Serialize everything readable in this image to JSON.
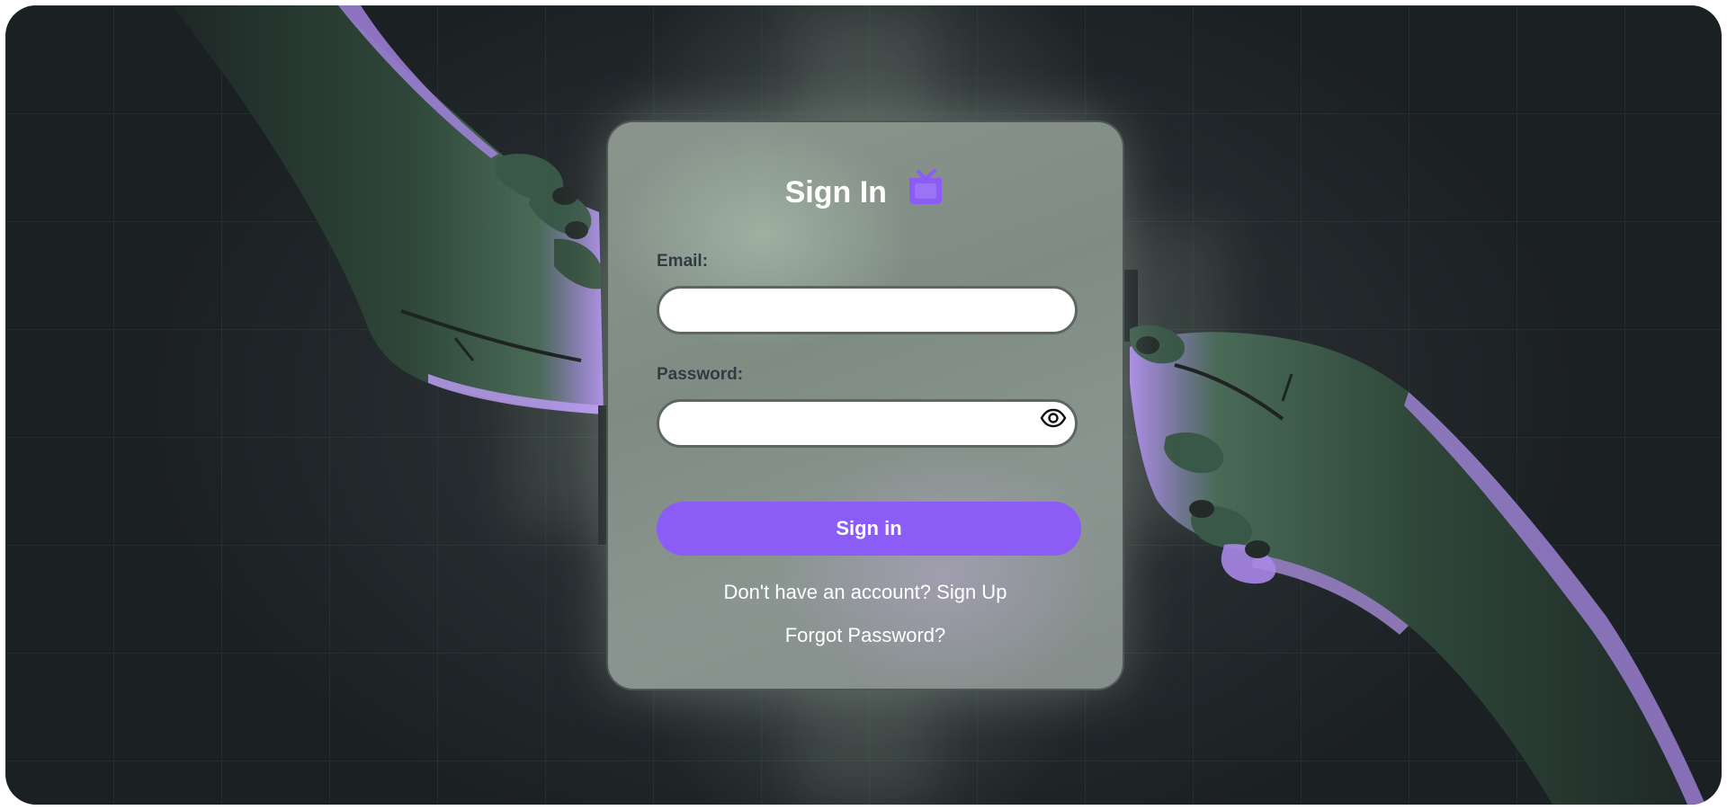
{
  "form": {
    "title": "Sign In",
    "email_label": "Email:",
    "email_value": "",
    "password_label": "Password:",
    "password_value": "",
    "submit_label": "Sign in",
    "signup_prompt": "Don't have an account?",
    "signup_link": "Sign Up",
    "forgot_link": "Forgot Password?"
  },
  "icons": {
    "logo": "tv-logo-icon",
    "password_toggle": "eye-icon"
  },
  "colors": {
    "accent": "#8b5cf6",
    "background": "#1f2427",
    "hand_green": "#2f4a3c",
    "hand_purple": "#a987e6"
  }
}
